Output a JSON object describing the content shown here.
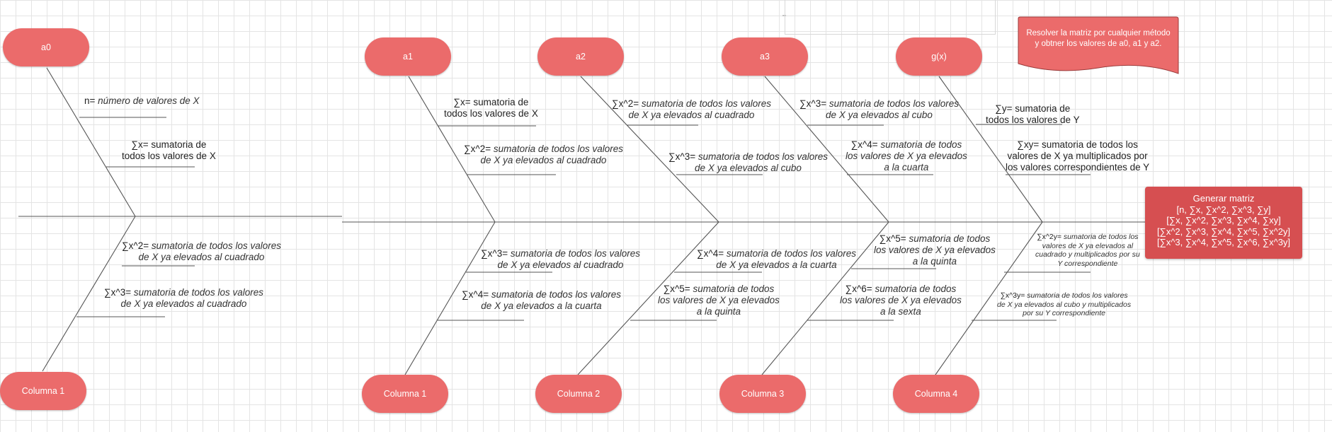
{
  "nodes": {
    "a0": "a0",
    "a1": "a1",
    "a2": "a2",
    "a3": "a3",
    "gx": "g(x)",
    "col1_left": "Columna 1",
    "col1": "Columna 1",
    "col2": "Columna 2",
    "col3": "Columna 3",
    "col4": "Columna 4"
  },
  "note": {
    "line1": "Resolver la matriz por cualquier método",
    "line2": "y obtner los valores de a0, a1 y a2."
  },
  "matrix": {
    "title": "Generar matriz",
    "row1": "[n, ∑x, ∑x^2, ∑x^3, ∑y]",
    "row2": "[∑x, ∑x^2, ∑x^3, ∑x^4, ∑xy]",
    "row3": "[∑x^2, ∑x^3, ∑x^4, ∑x^5, ∑x^2y]",
    "row4": "[∑x^3, ∑x^4, ∑x^5, ∑x^6, ∑x^3y]"
  },
  "labels": {
    "n_prefix": "n=",
    "n_desc": "número de valores de X",
    "sx_a0_l1": "∑x= sumatoria de",
    "sx_a0_l2": "todos los valores de X",
    "sx2_a0_prefix": "∑x^2=",
    "sx2_a0_l1": "sumatoria de todos los valores",
    "sx2_a0_l2": "de X ya elevados al cuadrado",
    "sx3_a0_prefix": "∑x^3=",
    "sx3_a0_l1": "sumatoria de todos los valores",
    "sx3_a0_l2": "de X ya elevados al cuadrado",
    "sx_a1_l1": "∑x= sumatoria de",
    "sx_a1_l2": "todos los valores de X",
    "sx2_a1_prefix": "∑x^2=",
    "sx2_a1_l1": "sumatoria de todos los valores",
    "sx2_a1_l2": "de X ya elevados al cuadrado",
    "sx3_a1_prefix": "∑x^3=",
    "sx3_a1_l1": "sumatoria de todos los valores",
    "sx3_a1_l2": "de X ya elevados al cuadrado",
    "sx4_a1_prefix": "∑x^4=",
    "sx4_a1_l1": "sumatoria de todos los valores",
    "sx4_a1_l2": "de X ya elevados a la cuarta",
    "sx2_a2_prefix": "∑x^2=",
    "sx2_a2_l1": "sumatoria de todos los valores",
    "sx2_a2_l2": "de X ya elevados al cuadrado",
    "sx3_a2_prefix": "∑x^3=",
    "sx3_a2_l1": "sumatoria de todos los valores",
    "sx3_a2_l2": "de X ya elevados al cubo",
    "sx4_a2_prefix": "∑x^4=",
    "sx4_a2_l1": "sumatoria de todos los valores",
    "sx4_a2_l2": "de X ya elevados a la cuarta",
    "sx5_a2_prefix": "∑x^5=",
    "sx5_a2_l1": "sumatoria de todos",
    "sx5_a2_l2": "los valores de X ya elevados",
    "sx5_a2_l3": "a la quinta",
    "sx3_a3_prefix": "∑x^3=",
    "sx3_a3_l1": "sumatoria de todos los valores",
    "sx3_a3_l2": "de X ya elevados al cubo",
    "sx4_a3_prefix": "∑x^4=",
    "sx4_a3_l1": "sumatoria de todos",
    "sx4_a3_l2": "los valores de X ya elevados",
    "sx4_a3_l3": "a la cuarta",
    "sx5_a3_prefix": "∑x^5=",
    "sx5_a3_l1": "sumatoria de todos",
    "sx5_a3_l2": "los valores de X ya elevados",
    "sx5_a3_l3": "a la quinta",
    "sx6_a3_prefix": "∑x^6=",
    "sx6_a3_l1": "sumatoria de todos",
    "sx6_a3_l2": "los valores de X ya elevados",
    "sx6_a3_l3": "a la sexta",
    "sy_l1": "∑y= sumatoria de",
    "sy_l2": "todos los valores de Y",
    "sxy_l1": "∑xy= sumatoria de todos los",
    "sxy_l2": "valores de X ya multiplicados por",
    "sxy_l3": "los valores correspondientes de Y",
    "sx2y_prefix": "∑x^2y=",
    "sx2y_l1": "sumatoria de todos los",
    "sx2y_l2": "valores de X ya elevados al",
    "sx2y_l3": "cuadrado y multiplicados por su",
    "sx2y_l4": "Y correspondiente",
    "sx3y_prefix": "∑x^3y=",
    "sx3y_l1": "sumatoria de todos los valores",
    "sx3y_l2": "de X ya elevados al cubo y multiplicados",
    "sx3y_l3": "por su Y correspondiente"
  },
  "colors": {
    "node": "#eb6b6b",
    "matrix": "#d64f51",
    "line": "#555555"
  }
}
